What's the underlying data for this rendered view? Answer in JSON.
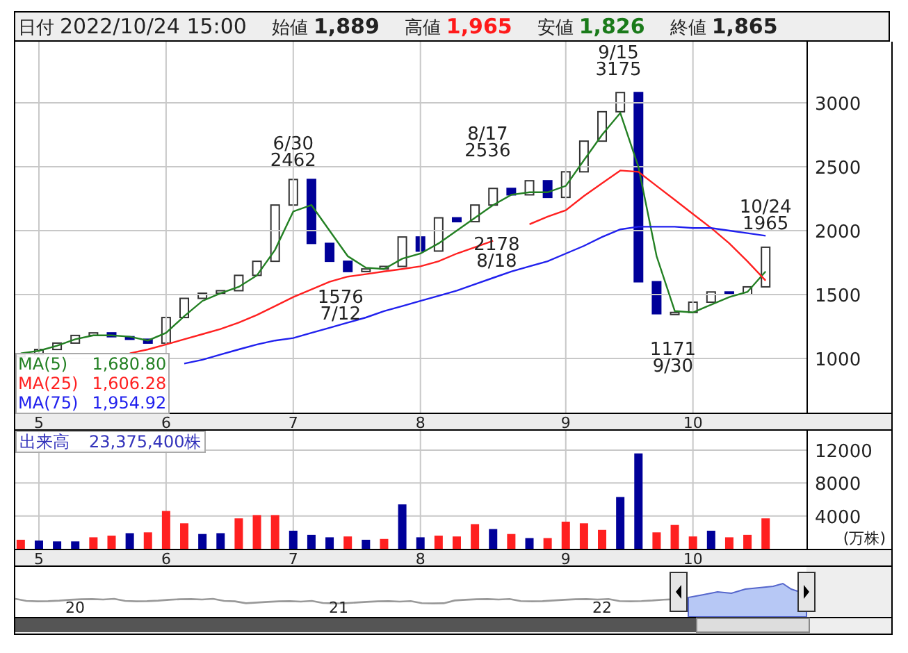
{
  "header": {
    "fields": [
      {
        "label": "日付",
        "value": "2022/10/24 15:00",
        "kind": "date"
      },
      {
        "label": "始値",
        "value": "1,889",
        "kind": "plain"
      },
      {
        "label": "高値",
        "value": "1,965",
        "kind": "up"
      },
      {
        "label": "安値",
        "value": "1,826",
        "kind": "down"
      },
      {
        "label": "終値",
        "value": "1,865",
        "kind": "plain"
      }
    ]
  },
  "price_panel": {
    "chart_data": {
      "type": "line",
      "categories": [
        null,
        "5",
        null,
        null,
        null,
        null,
        null,
        null,
        "6",
        null,
        null,
        null,
        null,
        null,
        null,
        "7",
        null,
        null,
        null,
        null,
        null,
        null,
        "8",
        null,
        null,
        null,
        null,
        null,
        null,
        null,
        "9",
        null,
        null,
        null,
        null,
        null,
        null,
        "10",
        null,
        null,
        null,
        null
      ],
      "ylim": [
        576,
        3478
      ],
      "yticks": [
        1000,
        1500,
        2000,
        2500,
        3000
      ],
      "grid": true,
      "series": [
        {
          "name": "MA(5)",
          "color": "#238023",
          "values": [
            1040,
            1060,
            1100,
            1150,
            1180,
            1180,
            1170,
            1140,
            1200,
            1330,
            1450,
            1510,
            1560,
            1650,
            1850,
            2150,
            2200,
            2000,
            1800,
            1710,
            1700,
            1780,
            1820,
            1900,
            2000,
            2100,
            2200,
            2280,
            2300,
            2300,
            2350,
            2550,
            2750,
            2920,
            2500,
            1800,
            1370,
            1360,
            1420,
            1480,
            1520,
            1680
          ]
        },
        {
          "name": "MA(25)",
          "color": "#ff2020",
          "values": [
            null,
            null,
            null,
            null,
            null,
            null,
            1040,
            1070,
            1110,
            1150,
            1190,
            1230,
            1280,
            1340,
            1410,
            1480,
            1540,
            1600,
            1640,
            1660,
            1680,
            1700,
            1720,
            1760,
            1820,
            1870,
            1920,
            null,
            2050,
            2110,
            2160,
            2270,
            2370,
            2470,
            2460,
            2350,
            2240,
            2130,
            2020,
            1900,
            1760,
            1610
          ]
        },
        {
          "name": "MA(75)",
          "color": "#2020ee",
          "values": [
            null,
            null,
            null,
            null,
            null,
            null,
            null,
            null,
            null,
            960,
            990,
            1030,
            1070,
            1110,
            1140,
            1160,
            1200,
            1240,
            1280,
            1320,
            1370,
            1410,
            1450,
            1490,
            1530,
            1580,
            1630,
            1680,
            1720,
            1760,
            1820,
            1880,
            1950,
            2010,
            2030,
            2030,
            2030,
            2020,
            2020,
            2000,
            1980,
            1960
          ]
        }
      ],
      "annotations": [
        "6/30\n2462",
        "8/17\n2536",
        "9/15\n3175",
        "10/24\n1965",
        "1576\n7/12",
        "2178\n8/18",
        "1171\n9/30"
      ]
    },
    "legend_values": [
      "1,680.80",
      "1,606.28",
      "1,954.92"
    ]
  },
  "volume_panel": {
    "total": "23,375,400株",
    "chart_data": {
      "type": "bar",
      "categories": [
        null,
        "5",
        null,
        null,
        null,
        null,
        null,
        null,
        "6",
        null,
        null,
        null,
        null,
        null,
        null,
        "7",
        null,
        null,
        null,
        null,
        null,
        null,
        "8",
        null,
        null,
        null,
        null,
        null,
        null,
        null,
        "9",
        null,
        null,
        null,
        null,
        null,
        null,
        "10",
        null,
        null,
        null,
        null
      ],
      "ylim": [
        0,
        14360
      ],
      "ylabel": "(万株)",
      "grid": true,
      "yticks": [
        4000,
        8000,
        12000
      ],
      "series": [
        {
          "name": "出来高",
          "color": "#ff2020",
          "values": [
            1100,
            null,
            null,
            null,
            1400,
            1600,
            null,
            2000,
            4600,
            3100,
            null,
            null,
            3700,
            4100,
            4100,
            null,
            null,
            null,
            1500,
            null,
            1200,
            null,
            null,
            1600,
            1500,
            3000,
            null,
            1800,
            null,
            1300,
            3300,
            3100,
            2300,
            null,
            null,
            2000,
            2900,
            1500,
            null,
            1400,
            1700,
            3700
          ]
        },
        {
          "color": "#000099",
          "values": [
            null,
            1000,
            900,
            900,
            null,
            null,
            1900,
            null,
            null,
            null,
            1800,
            1900,
            null,
            null,
            null,
            2200,
            1700,
            1400,
            null,
            1100,
            null,
            5400,
            1400,
            null,
            null,
            null,
            2400,
            null,
            1300,
            null,
            null,
            null,
            null,
            6300,
            11600,
            null,
            null,
            null,
            2200,
            null,
            null,
            null
          ]
        }
      ]
    }
  },
  "navigator": {
    "year_labels": [
      "20",
      "21",
      "22"
    ]
  }
}
